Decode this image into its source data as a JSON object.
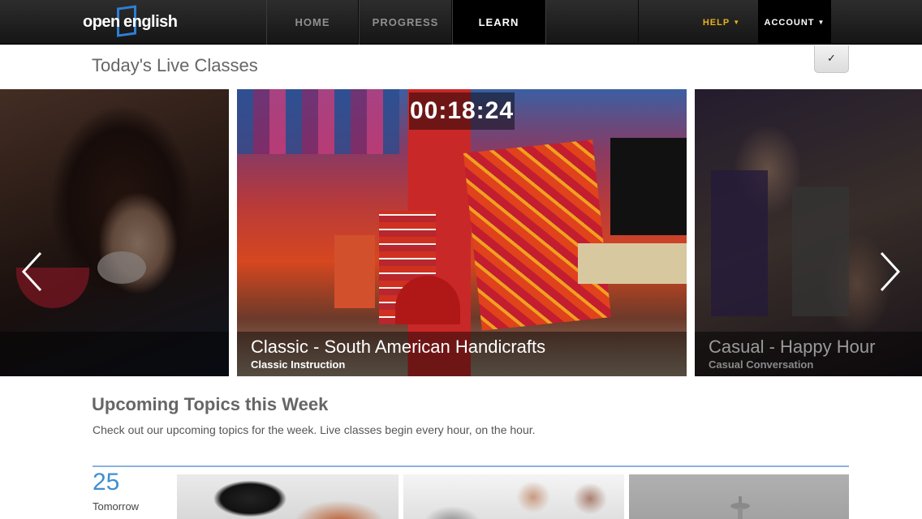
{
  "brand": {
    "logo_word1": "open",
    "logo_word2": "english",
    "accent": "#2d7fd6"
  },
  "nav": {
    "items": [
      {
        "label": "HOME",
        "active": false
      },
      {
        "label": "PROGRESS",
        "active": false
      },
      {
        "label": "LEARN",
        "active": true
      },
      {
        "label": "",
        "active": false
      }
    ],
    "help_label": "HELP",
    "account_label": "ACCOUNT",
    "help_color": "#e8b21c",
    "caret_icon": "caret-down-icon"
  },
  "live_classes": {
    "title": "Today's Live Classes",
    "check_glyph": "✓",
    "timer": "00:18:24",
    "slides": [
      {
        "title": "",
        "subtitle": ""
      },
      {
        "title": "Classic - South American Handicrafts",
        "subtitle": "Classic Instruction"
      },
      {
        "title": "Casual - Happy Hour",
        "subtitle": "Casual Conversation"
      }
    ]
  },
  "upcoming": {
    "title": "Upcoming Topics this Week",
    "description": "Check out our upcoming topics for the week. Live classes begin every hour, on the hour.",
    "day_number": "25",
    "day_label": "Tomorrow",
    "divider_color": "#8ab4dc",
    "number_color": "#3f8fd2"
  }
}
